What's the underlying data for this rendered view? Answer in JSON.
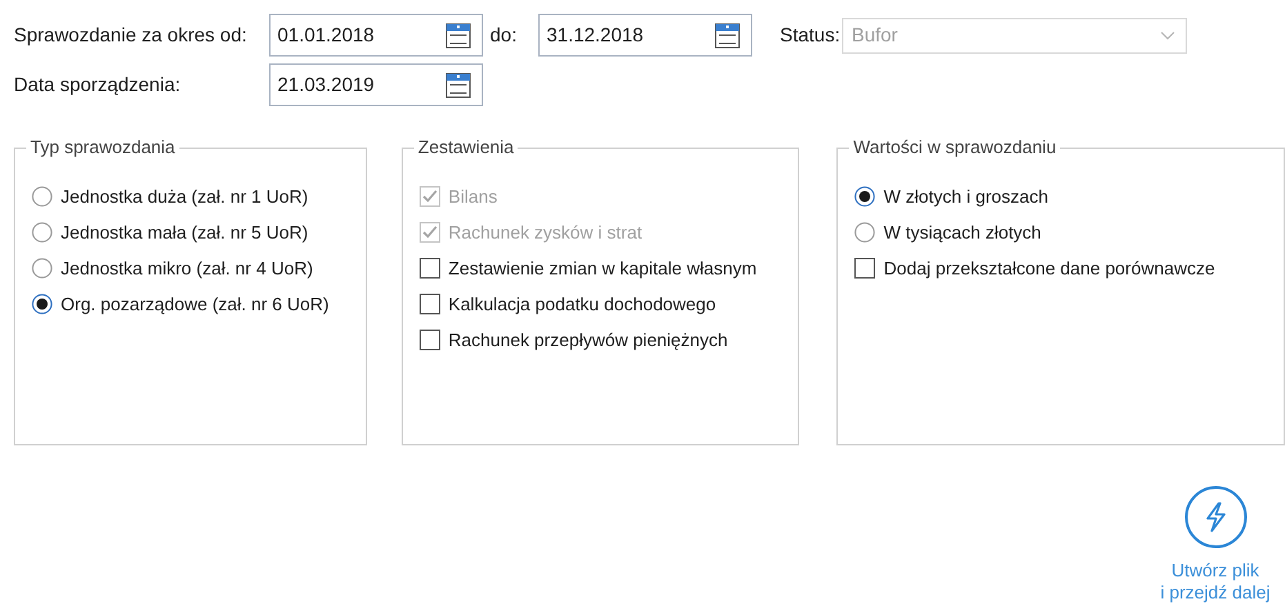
{
  "period": {
    "label": "Sprawozdanie za okres od:",
    "from": "01.01.2018",
    "to_label": "do:",
    "to": "31.12.2018"
  },
  "status": {
    "label": "Status:",
    "value": "Bufor",
    "disabled": true
  },
  "date_created": {
    "label": "Data sporządzenia:",
    "value": "21.03.2019"
  },
  "report_type": {
    "title": "Typ sprawozdania",
    "options": [
      {
        "label": "Jednostka duża (zał. nr 1 UoR)",
        "selected": false
      },
      {
        "label": "Jednostka mała (zał. nr 5 UoR)",
        "selected": false
      },
      {
        "label": "Jednostka mikro (zał. nr 4 UoR)",
        "selected": false
      },
      {
        "label": "Org. pozarządowe (zał. nr 6 UoR)",
        "selected": true
      }
    ]
  },
  "statements": {
    "title": "Zestawienia",
    "items": [
      {
        "label": "Bilans",
        "checked": true,
        "disabled": true
      },
      {
        "label": "Rachunek zysków i strat",
        "checked": true,
        "disabled": true
      },
      {
        "label": "Zestawienie zmian w kapitale własnym",
        "checked": false,
        "disabled": false
      },
      {
        "label": "Kalkulacja podatku dochodowego",
        "checked": false,
        "disabled": false
      },
      {
        "label": "Rachunek przepływów pieniężnych",
        "checked": false,
        "disabled": false
      }
    ]
  },
  "values": {
    "title": "Wartości w sprawozdaniu",
    "items": [
      {
        "kind": "radio",
        "label": "W złotych i groszach",
        "selected": true
      },
      {
        "kind": "radio",
        "label": "W tysiącach złotych",
        "selected": false
      },
      {
        "kind": "checkbox",
        "label": "Dodaj przekształcone dane porównawcze",
        "checked": false
      }
    ]
  },
  "action": {
    "lines": [
      "Utwórz plik",
      "i przejdź dalej"
    ]
  }
}
